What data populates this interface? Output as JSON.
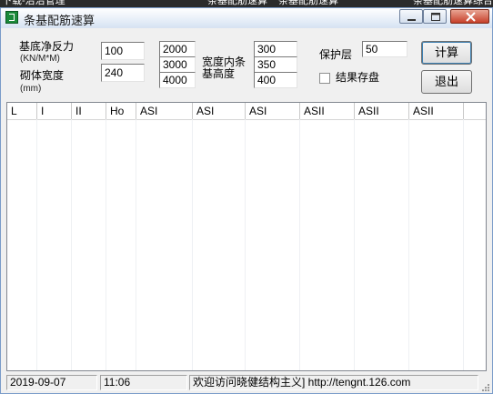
{
  "background_tabs": [
    "下载-治治管理",
    "条基配筋速算",
    "条基配筋速算",
    "条基配筋速算综合"
  ],
  "window": {
    "title": "条基配筋速算"
  },
  "form": {
    "pressure_label": "基底净反力",
    "pressure_unit": "(KN/M*M)",
    "pressure_value": "100",
    "wall_label": "砌体宽度",
    "wall_unit": "(mm)",
    "wall_value": "240",
    "width_values": [
      "2000",
      "3000",
      "4000"
    ],
    "height_label_line1": "宽度内条",
    "height_label_line2": "基高度",
    "height_values": [
      "300",
      "350",
      "400"
    ],
    "cover_label": "保护层",
    "cover_value": "50",
    "save_label": "结果存盘",
    "save_checked": false,
    "calc_button": "计算",
    "exit_button": "退出"
  },
  "table": {
    "columns": [
      "L",
      "I",
      "II",
      "Ho",
      "ASI",
      "ASI",
      "ASI",
      "ASII",
      "ASII",
      "ASII"
    ],
    "rows": []
  },
  "statusbar": {
    "date": "2019-09-07",
    "time": "11:06",
    "message": "欢迎访问晓健结构主义] http://tengnt.126.com"
  },
  "colors": {
    "accent": "#1a8a3a",
    "close_button": "#c7402a",
    "titlebar": "#e6eef8"
  }
}
